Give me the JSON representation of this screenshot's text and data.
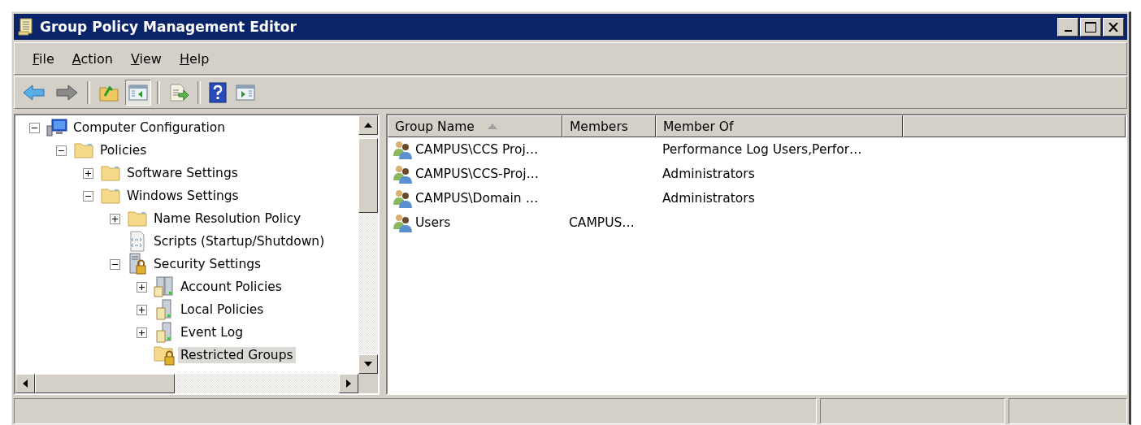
{
  "window": {
    "title": "Group Policy Management Editor"
  },
  "menu": [
    {
      "label": "File"
    },
    {
      "label": "Action"
    },
    {
      "label": "View"
    },
    {
      "label": "Help"
    }
  ],
  "toolbar": [
    {
      "kind": "back",
      "pressed": false
    },
    {
      "kind": "forward",
      "pressed": false
    },
    {
      "kind": "separator"
    },
    {
      "kind": "up",
      "pressed": false
    },
    {
      "kind": "tree-toggle",
      "pressed": true
    },
    {
      "kind": "separator"
    },
    {
      "kind": "export",
      "pressed": false
    },
    {
      "kind": "separator"
    },
    {
      "kind": "help",
      "pressed": false
    },
    {
      "kind": "action-pane",
      "pressed": false
    }
  ],
  "tree": [
    {
      "label": "Computer Configuration",
      "kind": "computer",
      "expanded": true,
      "selected": false,
      "children": [
        {
          "label": "Policies",
          "kind": "folder",
          "expanded": true,
          "selected": false,
          "children": [
            {
              "label": "Software Settings",
              "kind": "folder",
              "expanded": false,
              "selected": false
            },
            {
              "label": "Windows Settings",
              "kind": "folder",
              "expanded": true,
              "selected": false,
              "children": [
                {
                  "label": "Name Resolution Policy",
                  "kind": "folder",
                  "expanded": false,
                  "selected": false
                },
                {
                  "label": "Scripts (Startup/Shutdown)",
                  "kind": "script",
                  "selected": false
                },
                {
                  "label": "Security Settings",
                  "kind": "security",
                  "expanded": true,
                  "selected": false,
                  "children": [
                    {
                      "label": "Account Policies",
                      "kind": "servers",
                      "expanded": false,
                      "selected": false
                    },
                    {
                      "label": "Local Policies",
                      "kind": "server",
                      "expanded": false,
                      "selected": false
                    },
                    {
                      "label": "Event Log",
                      "kind": "server",
                      "expanded": false,
                      "selected": false
                    },
                    {
                      "label": "Restricted Groups",
                      "kind": "lockfolder",
                      "selected": true
                    }
                  ]
                }
              ]
            }
          ]
        }
      ]
    }
  ],
  "list": {
    "columns": [
      {
        "label": "Group Name",
        "sorted": true
      },
      {
        "label": "Members",
        "sorted": false
      },
      {
        "label": "Member Of",
        "sorted": false
      }
    ],
    "rows": [
      {
        "group_name": "CAMPUS\\CCS Proj…",
        "member_of": "Performance Log Users,Perfor…"
      },
      {
        "group_name": "CAMPUS\\CCS-Proj…",
        "member_of": "Administrators"
      },
      {
        "group_name": "CAMPUS\\Domain …",
        "member_of": "Administrators"
      },
      {
        "group_name": "Users",
        "members": "CAMPUS…"
      }
    ]
  }
}
